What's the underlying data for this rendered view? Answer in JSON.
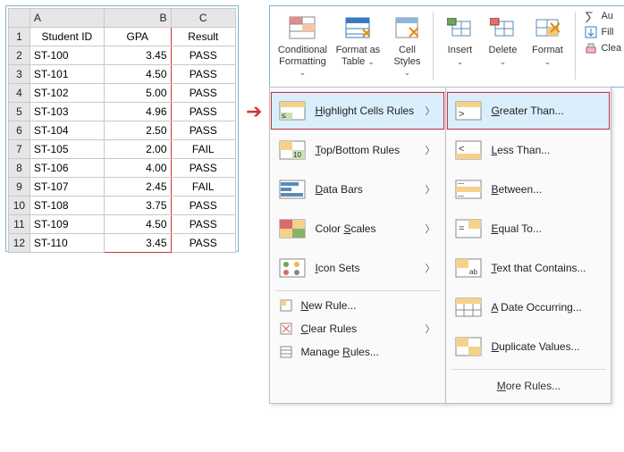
{
  "sheet": {
    "columns": [
      "",
      "A",
      "B",
      "C"
    ],
    "headerRow": [
      "1",
      "Student ID",
      "GPA",
      "Result"
    ],
    "rows": [
      {
        "n": "2",
        "id": "ST-100",
        "gpa": "3.45",
        "res": "PASS"
      },
      {
        "n": "3",
        "id": "ST-101",
        "gpa": "4.50",
        "res": "PASS"
      },
      {
        "n": "4",
        "id": "ST-102",
        "gpa": "5.00",
        "res": "PASS"
      },
      {
        "n": "5",
        "id": "ST-103",
        "gpa": "4.96",
        "res": "PASS"
      },
      {
        "n": "6",
        "id": "ST-104",
        "gpa": "2.50",
        "res": "PASS"
      },
      {
        "n": "7",
        "id": "ST-105",
        "gpa": "2.00",
        "res": "FAIL"
      },
      {
        "n": "8",
        "id": "ST-106",
        "gpa": "4.00",
        "res": "PASS"
      },
      {
        "n": "9",
        "id": "ST-107",
        "gpa": "2.45",
        "res": "FAIL"
      },
      {
        "n": "10",
        "id": "ST-108",
        "gpa": "3.75",
        "res": "PASS"
      },
      {
        "n": "11",
        "id": "ST-109",
        "gpa": "4.50",
        "res": "PASS"
      },
      {
        "n": "12",
        "id": "ST-110",
        "gpa": "3.45",
        "res": "PASS"
      }
    ]
  },
  "ribbon": {
    "condfmt": "Conditional Formatting",
    "fmtTable": "Format as Table",
    "cellStyles": "Cell Styles",
    "insert": "Insert",
    "delete": "Delete",
    "format": "Format",
    "autosum": "Au",
    "fill": "Fill",
    "clear": "Clea"
  },
  "menu1": {
    "highlight": "Highlight Cells Rules",
    "topbottom": "Top/Bottom Rules",
    "databars": "Data Bars",
    "colorscales": "Color Scales",
    "iconsets": "Icon Sets",
    "newrule": "New Rule...",
    "clearrules": "Clear Rules",
    "managerules": "Manage Rules..."
  },
  "menu2": {
    "greater": "Greater Than...",
    "less": "Less Than...",
    "between": "Between...",
    "equal": "Equal To...",
    "textcontains": "Text that Contains...",
    "dateocc": "A Date Occurring...",
    "dupvals": "Duplicate Values...",
    "more": "More Rules..."
  }
}
